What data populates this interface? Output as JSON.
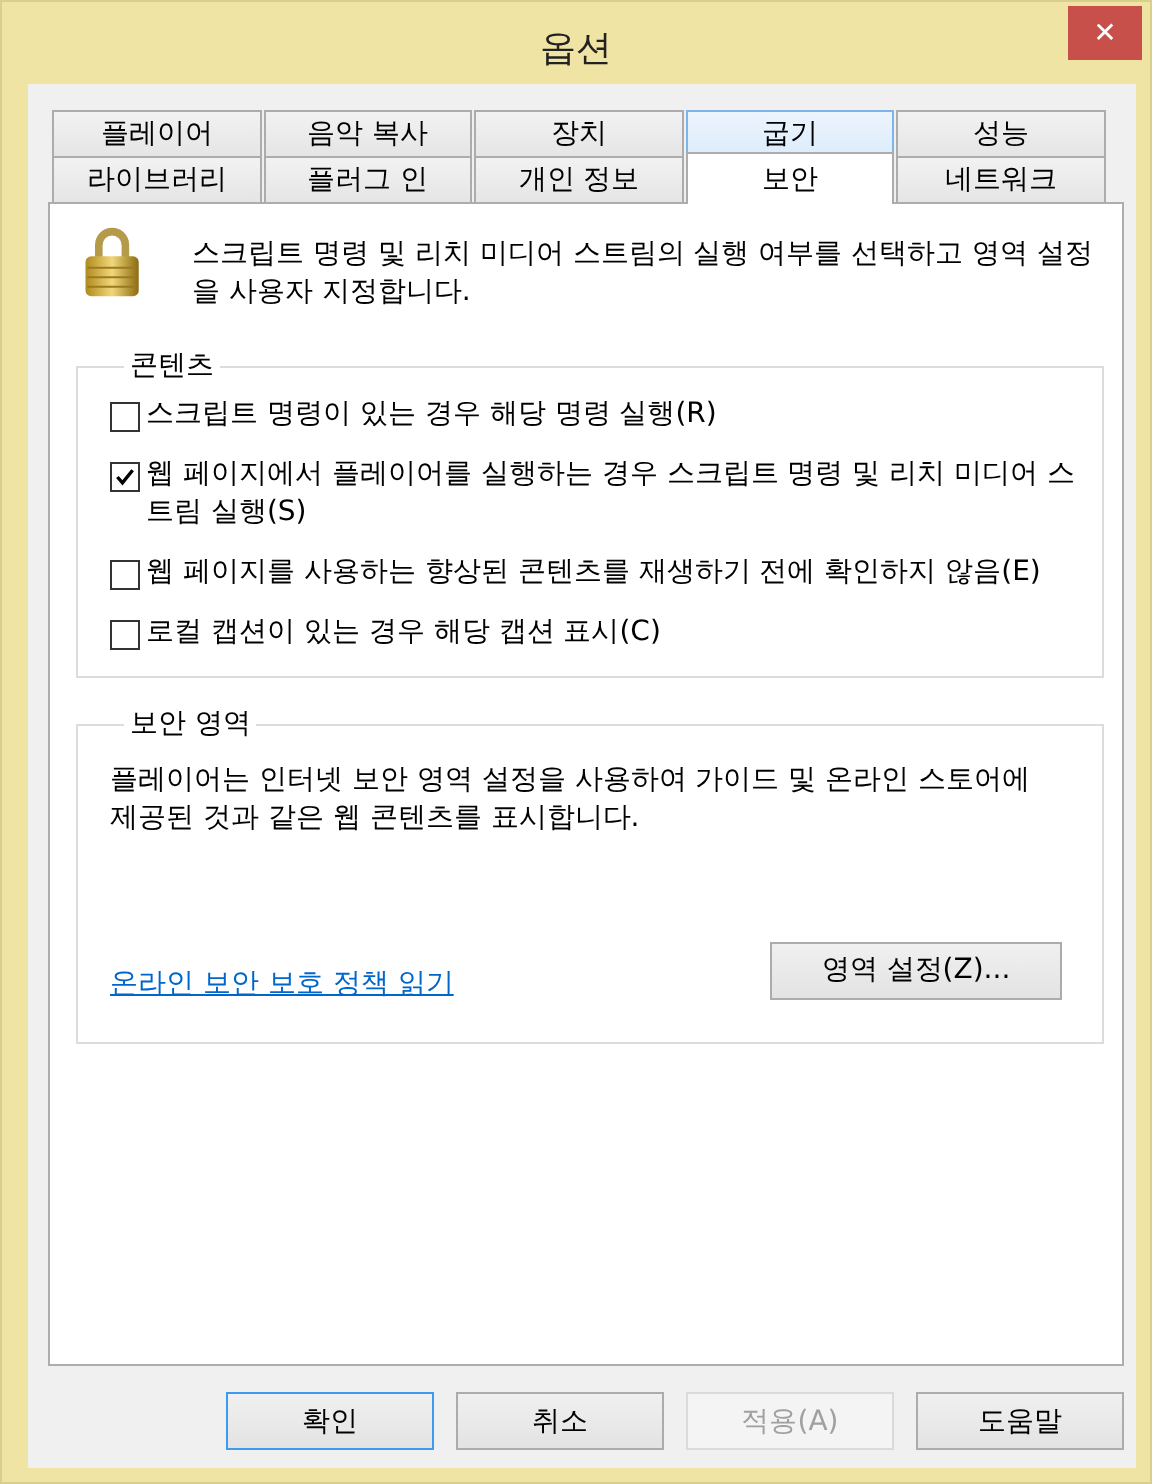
{
  "window": {
    "title": "옵션",
    "close": "✕"
  },
  "tab_rows": [
    [
      {
        "label": "플레이어",
        "selected": false,
        "hover": false
      },
      {
        "label": "음악 복사",
        "selected": false,
        "hover": false
      },
      {
        "label": "장치",
        "selected": false,
        "hover": false
      },
      {
        "label": "굽기",
        "selected": false,
        "hover": true
      },
      {
        "label": "성능",
        "selected": false,
        "hover": false
      }
    ],
    [
      {
        "label": "라이브러리",
        "selected": false,
        "hover": false
      },
      {
        "label": "플러그 인",
        "selected": false,
        "hover": false
      },
      {
        "label": "개인 정보",
        "selected": false,
        "hover": false
      },
      {
        "label": "보안",
        "selected": true,
        "hover": false
      },
      {
        "label": "네트워크",
        "selected": false,
        "hover": false
      }
    ]
  ],
  "description": "스크립트 명령 및 리치 미디어 스트림의 실행 여부를 선택하고 영역 설정을 사용자 지정합니다.",
  "content_group": {
    "title": "콘텐츠",
    "options": [
      {
        "label": "스크립트 명령이 있는 경우 해당 명령 실행(R)",
        "checked": false
      },
      {
        "label": "웹 페이지에서 플레이어를 실행하는 경우 스크립트 명령 및 리치 미디어 스트림 실행(S)",
        "checked": true
      },
      {
        "label": "웹 페이지를 사용하는 향상된 콘텐츠를 재생하기 전에 확인하지 않음(E)",
        "checked": false
      },
      {
        "label": "로컬 캡션이 있는 경우 해당 캡션 표시(C)",
        "checked": false
      }
    ]
  },
  "zone_group": {
    "title": "보안 영역",
    "text": "플레이어는 인터넷 보안 영역 설정을 사용하여 가이드 및 온라인 스토어에 제공된 것과 같은 웹 콘텐츠를 표시합니다.",
    "link": "온라인 보안 보호 정책 읽기",
    "button": "영역 설정(Z)..."
  },
  "buttons": [
    {
      "label": "확인",
      "disabled": false,
      "default": true
    },
    {
      "label": "취소",
      "disabled": false,
      "default": false
    },
    {
      "label": "적용(A)",
      "disabled": true,
      "default": false
    },
    {
      "label": "도움말",
      "disabled": false,
      "default": false
    }
  ]
}
